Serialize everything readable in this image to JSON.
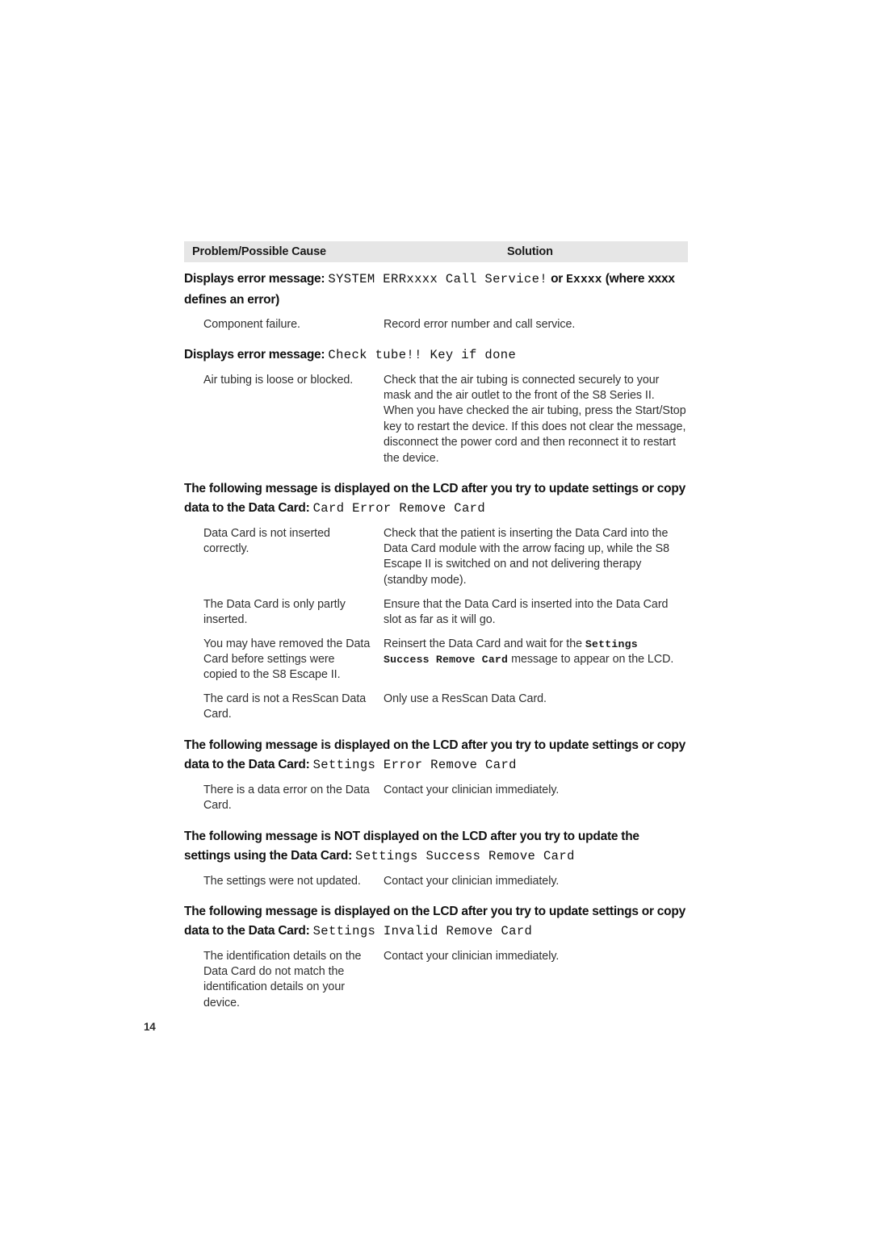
{
  "page": {
    "number": "14",
    "background_color": "#ffffff",
    "header_band_color": "#e6e6e6",
    "body_text_color": "#303030",
    "heading_text_color": "#111111"
  },
  "table": {
    "columns": {
      "problem": "Problem/Possible Cause",
      "solution": "Solution"
    },
    "sections": [
      {
        "id": "system-err",
        "heading": {
          "parts": [
            {
              "text": "Displays error message: ",
              "style": "bold"
            },
            {
              "text": "SYSTEM ERRxxxx Call Service!",
              "style": "mono"
            },
            {
              "text": " or ",
              "style": "bold"
            },
            {
              "text": "Exxxx",
              "style": "mono-bold"
            },
            {
              "text": " (where xxxx defines an error)",
              "style": "bold"
            }
          ]
        },
        "rows": [
          {
            "problem": [
              {
                "text": "Component failure.",
                "style": "normal"
              }
            ],
            "solution": [
              {
                "text": "Record error number and call service.",
                "style": "normal"
              }
            ]
          }
        ]
      },
      {
        "id": "check-tube",
        "heading": {
          "parts": [
            {
              "text": "Displays error message: ",
              "style": "bold"
            },
            {
              "text": "Check tube!! Key if done",
              "style": "mono"
            }
          ]
        },
        "rows": [
          {
            "problem": [
              {
                "text": "Air tubing is loose or blocked.",
                "style": "normal"
              }
            ],
            "solution": [
              {
                "text": "Check that the air tubing is connected securely to your mask and the air outlet to the front of the S8 Series II. When you have checked the air tubing, press the Start/Stop key to restart the device. If this does not clear the message, disconnect the power cord and then reconnect it to restart the device.",
                "style": "normal"
              }
            ]
          }
        ]
      },
      {
        "id": "card-error-remove-card",
        "heading": {
          "parts": [
            {
              "text": "The following message is displayed on the LCD after you try to update settings or copy data to the Data Card: ",
              "style": "bold"
            },
            {
              "text": "Card Error Remove Card",
              "style": "mono"
            }
          ]
        },
        "rows": [
          {
            "problem": [
              {
                "text": "Data Card is not inserted correctly.",
                "style": "normal"
              }
            ],
            "solution": [
              {
                "text": "Check that the patient is inserting the Data Card into the Data Card module with the arrow facing up, while the S8 Escape II is switched on and not delivering therapy (standby mode).",
                "style": "normal"
              }
            ]
          },
          {
            "problem": [
              {
                "text": "The Data Card is only partly inserted.",
                "style": "normal"
              }
            ],
            "solution": [
              {
                "text": "Ensure that the Data Card is inserted into the Data Card slot as far as it will go.",
                "style": "normal"
              }
            ]
          },
          {
            "problem": [
              {
                "text": "You may have removed the Data Card before settings were copied to the S8 Escape II.",
                "style": "normal"
              }
            ],
            "solution": [
              {
                "text": "Reinsert the Data Card and wait for the ",
                "style": "normal"
              },
              {
                "text": "Settings Success Remove Card",
                "style": "mono-bold"
              },
              {
                "text": " message to appear on the LCD.",
                "style": "normal"
              }
            ]
          },
          {
            "problem": [
              {
                "text": "The card is not a ResScan Data Card.",
                "style": "normal"
              }
            ],
            "solution": [
              {
                "text": "Only use a ResScan Data Card.",
                "style": "normal"
              }
            ]
          }
        ]
      },
      {
        "id": "settings-error-remove-card",
        "heading": {
          "parts": [
            {
              "text": "The following message is displayed on the LCD after you try to update settings or copy data to the Data Card: ",
              "style": "bold"
            },
            {
              "text": "Settings Error Remove Card",
              "style": "mono"
            }
          ]
        },
        "rows": [
          {
            "problem": [
              {
                "text": "There is a data error on the Data Card.",
                "style": "normal"
              }
            ],
            "solution": [
              {
                "text": "Contact your clinician immediately.",
                "style": "normal"
              }
            ]
          }
        ]
      },
      {
        "id": "settings-success-remove-card",
        "heading": {
          "parts": [
            {
              "text": "The following message is NOT displayed on the LCD after you try to update the settings using the Data Card: ",
              "style": "bold"
            },
            {
              "text": "Settings Success Remove Card",
              "style": "mono"
            }
          ]
        },
        "rows": [
          {
            "problem": [
              {
                "text": "The settings were not updated.",
                "style": "normal"
              }
            ],
            "solution": [
              {
                "text": "Contact your clinician immediately.",
                "style": "normal"
              }
            ]
          }
        ]
      },
      {
        "id": "settings-invalid-remove-card",
        "heading": {
          "parts": [
            {
              "text": "The following message is displayed on the LCD after you try to update settings or copy data to the Data Card: ",
              "style": "bold"
            },
            {
              "text": "Settings Invalid Remove Card",
              "style": "mono"
            }
          ]
        },
        "rows": [
          {
            "problem": [
              {
                "text": "The identification details on the Data Card do not match the identification details on your device.",
                "style": "normal"
              }
            ],
            "solution": [
              {
                "text": "Contact your clinician immediately.",
                "style": "normal"
              }
            ]
          }
        ]
      }
    ]
  }
}
